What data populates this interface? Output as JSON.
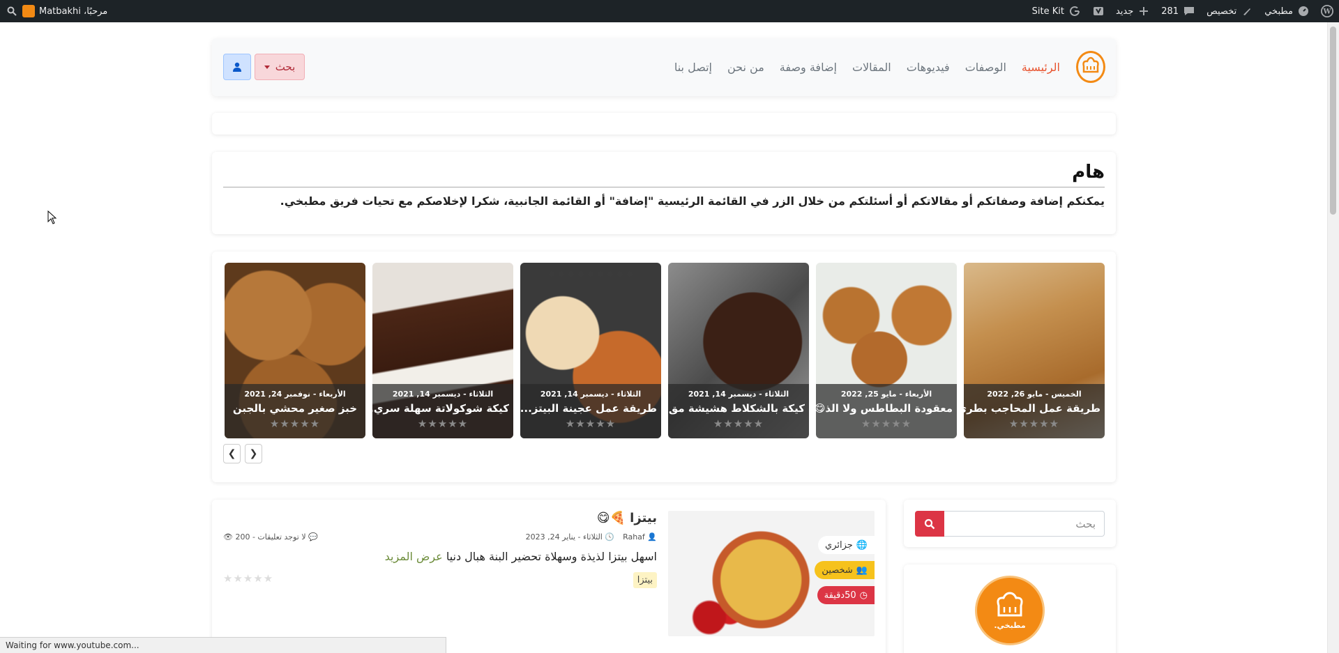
{
  "adminbar": {
    "site_name": "مطبخي",
    "customize": "تخصيص",
    "comments_count": "281",
    "new_label": "جديد",
    "sitekit": "Site Kit",
    "greeting": "مرحبًا، Matbakhi"
  },
  "nav": {
    "items": [
      {
        "label": "الرئيسية",
        "active": true
      },
      {
        "label": "الوصفات"
      },
      {
        "label": "فيديوهات"
      },
      {
        "label": "المقالات"
      },
      {
        "label": "إضافة وصفة"
      },
      {
        "label": "من نحن"
      },
      {
        "label": "إتصل بنا"
      }
    ],
    "search_label": "بحث"
  },
  "notice": {
    "title": "هام",
    "text": "يمكنكم إضافة وصفاتكم أو مقالاتكم أو أسئلتكم من خلال الزر في القائمة الرئيسية \"إضافة\" أو القائمة الجانبية، شكرا لإخلاصكم مع تحيات فريق مطبخي."
  },
  "slider": {
    "slides": [
      {
        "date": "الخميس - مايو 26, 2022",
        "title": "طريقة عمل المحاجب بطري...",
        "stars": "★★★★★"
      },
      {
        "date": "الأربعاء - مايو 25, 2022",
        "title": "معقودة البطاطس ولا الذ😋",
        "stars": "★★★★★"
      },
      {
        "date": "الثلاثاء - ديسمبر 14, 2021",
        "title": "كيكة بالشكلاط هشيشة مق...",
        "stars": "★★★★★"
      },
      {
        "date": "الثلاثاء - ديسمبر 14, 2021",
        "title": "طريقة عمل عجينة البيتز...",
        "stars": "★★★★★"
      },
      {
        "date": "الثلاثاء - ديسمبر 14, 2021",
        "title": "كيكة شوكولاتة سهلة سري...",
        "stars": "★★★★★"
      },
      {
        "date": "الأربعاء - نوفمبر 24, 2021",
        "title": "خبز صغير محشي بالجبن",
        "stars": "★★★★★"
      }
    ]
  },
  "sidebar": {
    "search_placeholder": "بحث",
    "logo_text": "مطبخي."
  },
  "post": {
    "title": "بيتزا 🍕😋",
    "author": "Rahaf",
    "date": "الثلاثاء - يناير 24, 2023",
    "comments": "لا توجد تعليقات - 200",
    "excerpt": "اسهل بيتزا لذيذة وسهلاة تحضير البنة هبال دنيا",
    "read_more": "عرض المزيد",
    "badge": "بيتزا",
    "stars": "★★★★★",
    "tag_origin": "جزائري",
    "tag_people": "شخصين",
    "tag_time": "50دقيقة"
  },
  "status_text": "Waiting for www.youtube.com..."
}
